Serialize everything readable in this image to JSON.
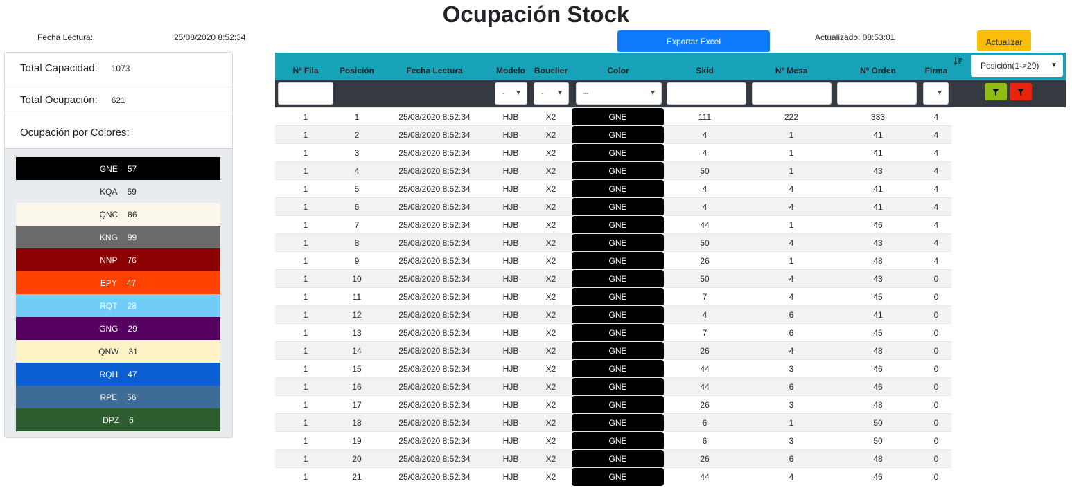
{
  "title": "Ocupación Stock",
  "fecha_lectura_label": "Fecha Lectura:",
  "fecha_lectura_value": "25/08/2020 8:52:34",
  "export_label": "Exportar Excel",
  "actualizado_label": "Actualizado: 08:53:01",
  "update_label": "Actualizar",
  "summary": {
    "capacidad_label": "Total Capacidad:",
    "capacidad_value": "1073",
    "ocupacion_label": "Total Ocupación:",
    "ocupacion_value": "621",
    "colores_label": "Ocupación por Colores:"
  },
  "colors": [
    {
      "name": "GNE",
      "count": "57",
      "bg": "#000000",
      "fg": "#ffffff"
    },
    {
      "name": "KQA",
      "count": "59",
      "bg": "#e9ecef",
      "fg": "#212529"
    },
    {
      "name": "QNC",
      "count": "86",
      "bg": "#fdf8ec",
      "fg": "#212529"
    },
    {
      "name": "KNG",
      "count": "99",
      "bg": "#6a6a6a",
      "fg": "#ffffff"
    },
    {
      "name": "NNP",
      "count": "76",
      "bg": "#8b0000",
      "fg": "#ffffff"
    },
    {
      "name": "EPY",
      "count": "47",
      "bg": "#ff4200",
      "fg": "#ffffff"
    },
    {
      "name": "RQT",
      "count": "28",
      "bg": "#6fcdf7",
      "fg": "#ffffff"
    },
    {
      "name": "GNG",
      "count": "29",
      "bg": "#560060",
      "fg": "#ffffff"
    },
    {
      "name": "QNW",
      "count": "31",
      "bg": "#fdf3c6",
      "fg": "#212529"
    },
    {
      "name": "RQH",
      "count": "47",
      "bg": "#0b5fd3",
      "fg": "#ffffff"
    },
    {
      "name": "RPE",
      "count": "56",
      "bg": "#3d6d96",
      "fg": "#ffffff"
    },
    {
      "name": "DPZ",
      "count": "6",
      "bg": "#2d5d2e",
      "fg": "#ffffff"
    }
  ],
  "table": {
    "headers": {
      "fila": "Nº Fila",
      "posicion": "Posición",
      "fecha": "Fecha Lectura",
      "modelo": "Modelo",
      "bouclier": "Bouclier",
      "color": "Color",
      "skid": "Skid",
      "mesa": "Nº Mesa",
      "orden": "Nº Orden",
      "firma": "Firma"
    },
    "sort_select": "Posición(1->29)",
    "filters": {
      "modelo": "-",
      "bouclier": "-",
      "color": "--"
    },
    "rows": [
      [
        "1",
        "1",
        "25/08/2020 8:52:34",
        "HJB",
        "X2",
        "GNE",
        "111",
        "222",
        "333",
        "4"
      ],
      [
        "1",
        "2",
        "25/08/2020 8:52:34",
        "HJB",
        "X2",
        "GNE",
        "4",
        "1",
        "41",
        "4"
      ],
      [
        "1",
        "3",
        "25/08/2020 8:52:34",
        "HJB",
        "X2",
        "GNE",
        "4",
        "1",
        "41",
        "4"
      ],
      [
        "1",
        "4",
        "25/08/2020 8:52:34",
        "HJB",
        "X2",
        "GNE",
        "50",
        "1",
        "43",
        "4"
      ],
      [
        "1",
        "5",
        "25/08/2020 8:52:34",
        "HJB",
        "X2",
        "GNE",
        "4",
        "4",
        "41",
        "4"
      ],
      [
        "1",
        "6",
        "25/08/2020 8:52:34",
        "HJB",
        "X2",
        "GNE",
        "4",
        "4",
        "41",
        "4"
      ],
      [
        "1",
        "7",
        "25/08/2020 8:52:34",
        "HJB",
        "X2",
        "GNE",
        "44",
        "1",
        "46",
        "4"
      ],
      [
        "1",
        "8",
        "25/08/2020 8:52:34",
        "HJB",
        "X2",
        "GNE",
        "50",
        "4",
        "43",
        "4"
      ],
      [
        "1",
        "9",
        "25/08/2020 8:52:34",
        "HJB",
        "X2",
        "GNE",
        "26",
        "1",
        "48",
        "4"
      ],
      [
        "1",
        "10",
        "25/08/2020 8:52:34",
        "HJB",
        "X2",
        "GNE",
        "50",
        "4",
        "43",
        "0"
      ],
      [
        "1",
        "11",
        "25/08/2020 8:52:34",
        "HJB",
        "X2",
        "GNE",
        "7",
        "4",
        "45",
        "0"
      ],
      [
        "1",
        "12",
        "25/08/2020 8:52:34",
        "HJB",
        "X2",
        "GNE",
        "4",
        "6",
        "41",
        "0"
      ],
      [
        "1",
        "13",
        "25/08/2020 8:52:34",
        "HJB",
        "X2",
        "GNE",
        "7",
        "6",
        "45",
        "0"
      ],
      [
        "1",
        "14",
        "25/08/2020 8:52:34",
        "HJB",
        "X2",
        "GNE",
        "26",
        "4",
        "48",
        "0"
      ],
      [
        "1",
        "15",
        "25/08/2020 8:52:34",
        "HJB",
        "X2",
        "GNE",
        "44",
        "3",
        "46",
        "0"
      ],
      [
        "1",
        "16",
        "25/08/2020 8:52:34",
        "HJB",
        "X2",
        "GNE",
        "44",
        "6",
        "46",
        "0"
      ],
      [
        "1",
        "17",
        "25/08/2020 8:52:34",
        "HJB",
        "X2",
        "GNE",
        "26",
        "3",
        "48",
        "0"
      ],
      [
        "1",
        "18",
        "25/08/2020 8:52:34",
        "HJB",
        "X2",
        "GNE",
        "6",
        "1",
        "50",
        "0"
      ],
      [
        "1",
        "19",
        "25/08/2020 8:52:34",
        "HJB",
        "X2",
        "GNE",
        "6",
        "3",
        "50",
        "0"
      ],
      [
        "1",
        "20",
        "25/08/2020 8:52:34",
        "HJB",
        "X2",
        "GNE",
        "26",
        "6",
        "48",
        "0"
      ],
      [
        "1",
        "21",
        "25/08/2020 8:52:34",
        "HJB",
        "X2",
        "GNE",
        "44",
        "4",
        "46",
        "0"
      ]
    ]
  }
}
